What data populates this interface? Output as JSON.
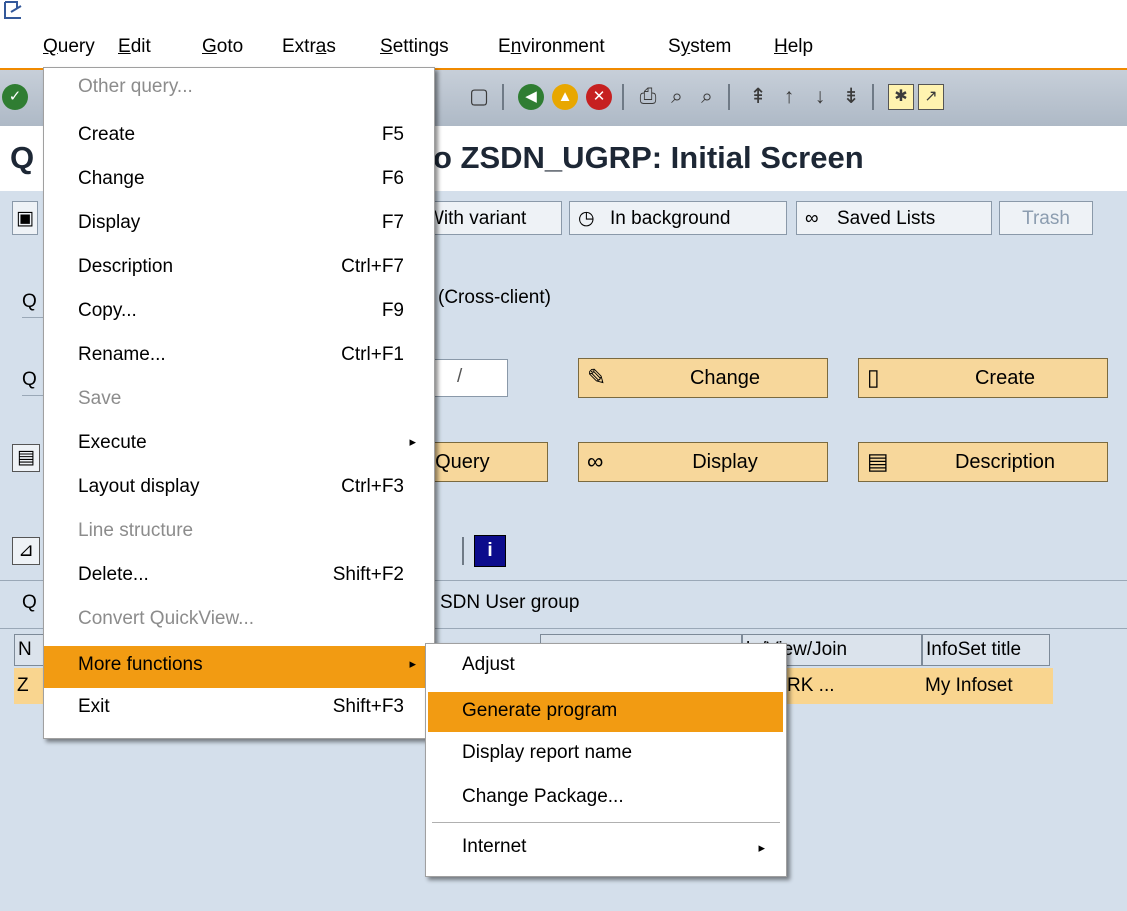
{
  "menubar": {
    "items": [
      "Query",
      "Edit",
      "Goto",
      "Extras",
      "Settings",
      "Environment",
      "System",
      "Help"
    ]
  },
  "title": "o ZSDN_UGRP: Initial Screen",
  "title_prefix": "Q",
  "appbar": {
    "with_variant": "With variant",
    "in_background": "In background",
    "saved_lists": "Saved Lists",
    "trash": "Trash"
  },
  "content": {
    "cross_client": "(Cross-client)",
    "label_q1": "Q",
    "label_q2": "Q",
    "label_q3": "Q",
    "input_partial": "/",
    "btn_change": "Change",
    "btn_create": "Create",
    "btn_query": "t Query",
    "btn_display": "Display",
    "btn_description": "Description",
    "user_group": "SDN User group",
    "row_label_n": "N",
    "row_label_z": "Z",
    "col_table_view_join": "le/View/Join",
    "col_infoset_title": "InfoSet title",
    "cell_rk": "RK ...",
    "cell_infoset": "My Infoset"
  },
  "menu": {
    "items": [
      {
        "label": "Other query...",
        "shortcut": "",
        "disabled": true
      },
      {
        "label": "Create",
        "shortcut": "F5"
      },
      {
        "label": "Change",
        "shortcut": "F6"
      },
      {
        "label": "Display",
        "shortcut": "F7"
      },
      {
        "label": "Description",
        "shortcut": "Ctrl+F7"
      },
      {
        "label": "Copy...",
        "shortcut": "F9"
      },
      {
        "label": "Rename...",
        "shortcut": "Ctrl+F1"
      },
      {
        "label": "Save",
        "shortcut": "",
        "disabled": true
      },
      {
        "label": "Execute",
        "shortcut": "",
        "submenu": true
      },
      {
        "label": "Layout display",
        "shortcut": "Ctrl+F3"
      },
      {
        "label": "Line structure",
        "shortcut": "",
        "disabled": true
      },
      {
        "label": "Delete...",
        "shortcut": "Shift+F2"
      },
      {
        "label": "Convert QuickView...",
        "shortcut": "",
        "disabled": true
      },
      {
        "label": "More functions",
        "shortcut": "",
        "submenu": true,
        "highlighted": true
      },
      {
        "label": "Exit",
        "shortcut": "Shift+F3"
      }
    ]
  },
  "submenu": {
    "items": [
      {
        "label": "Adjust"
      },
      {
        "label": "Generate program",
        "highlighted": true
      },
      {
        "label": "Display report name"
      },
      {
        "label": "Change Package..."
      },
      {
        "label": "Internet",
        "submenu": true
      }
    ]
  },
  "colors": {
    "accent": "#f29b12",
    "button": "#f7d79b",
    "background": "#d4dfeb"
  }
}
